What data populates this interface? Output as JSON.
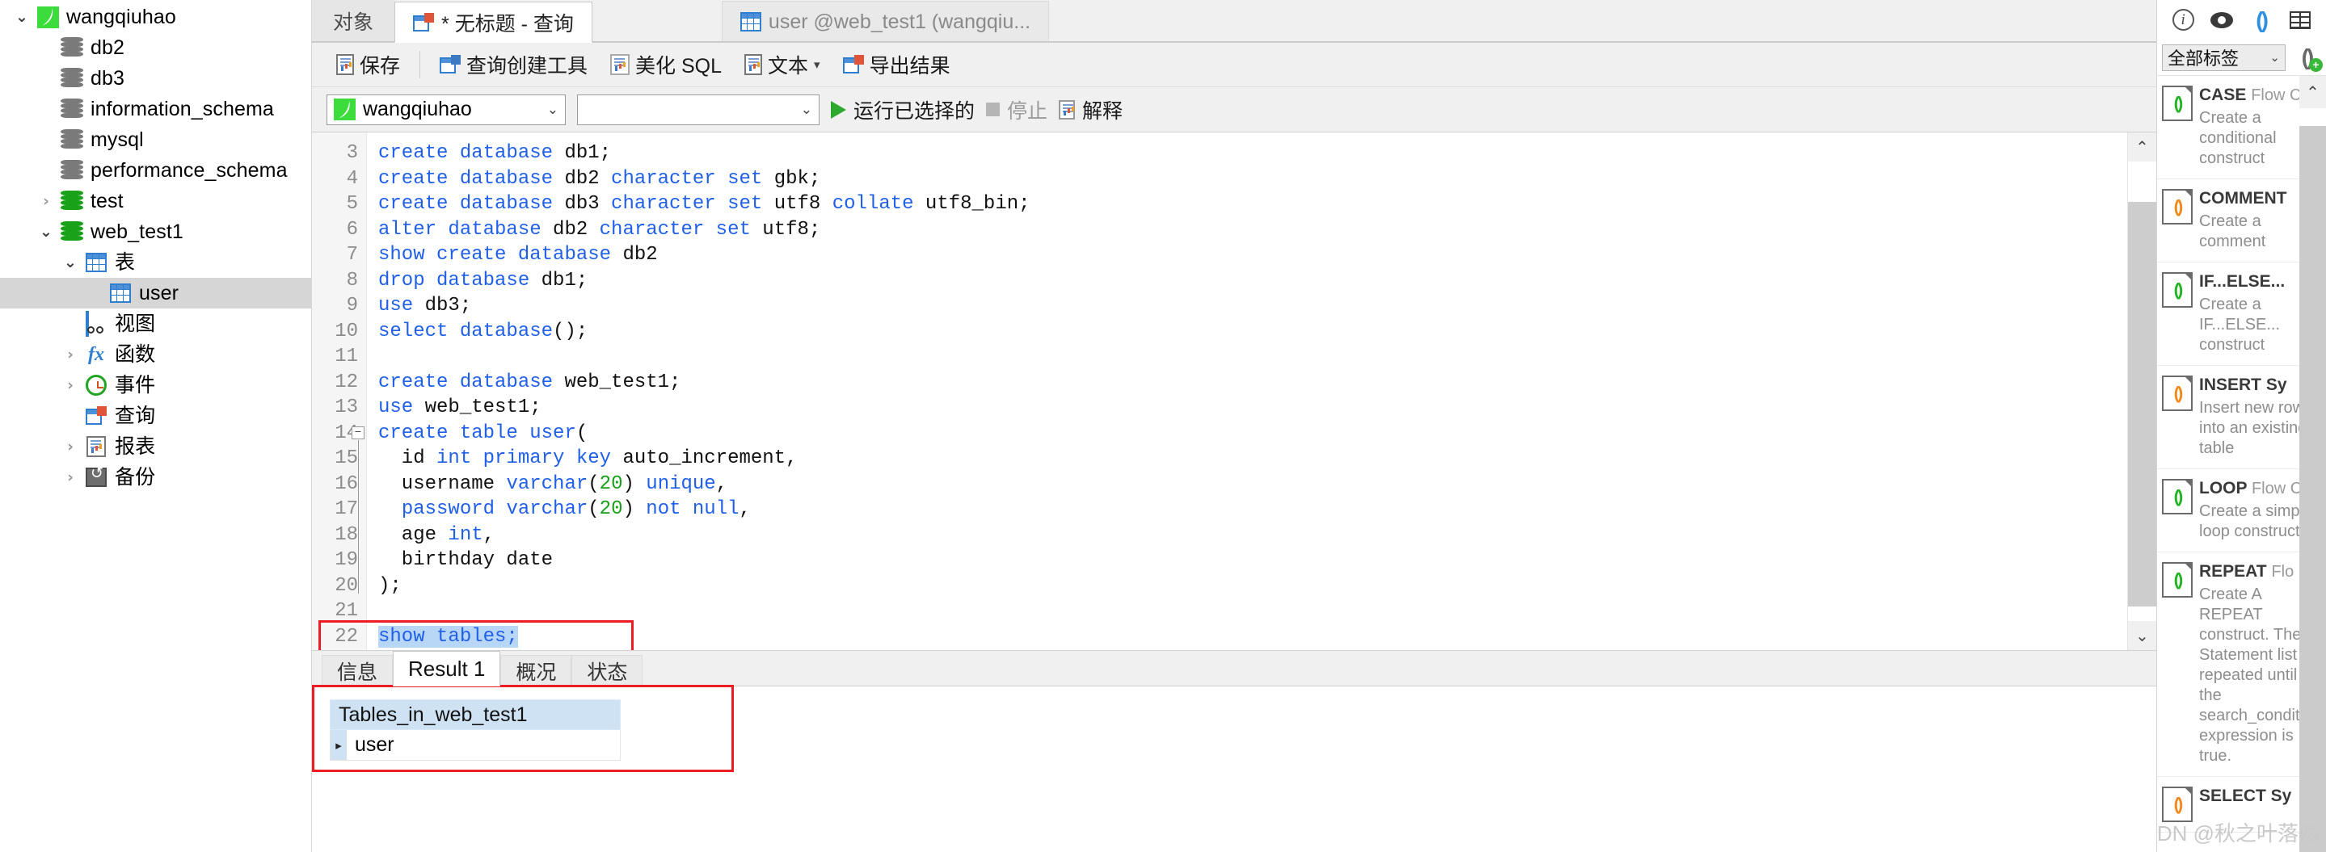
{
  "sidebar": {
    "items": [
      {
        "label": "wangqiuhao",
        "icon": "navicat-leaf-icon",
        "twisty": "open",
        "indent": 0,
        "selected": false
      },
      {
        "label": "db2",
        "icon": "database-gray-icon",
        "twisty": "none",
        "indent": 1,
        "selected": false
      },
      {
        "label": "db3",
        "icon": "database-gray-icon",
        "twisty": "none",
        "indent": 1,
        "selected": false
      },
      {
        "label": "information_schema",
        "icon": "database-gray-icon",
        "twisty": "none",
        "indent": 1,
        "selected": false
      },
      {
        "label": "mysql",
        "icon": "database-gray-icon",
        "twisty": "none",
        "indent": 1,
        "selected": false
      },
      {
        "label": "performance_schema",
        "icon": "database-gray-icon",
        "twisty": "none",
        "indent": 1,
        "selected": false
      },
      {
        "label": "test",
        "icon": "database-green-icon",
        "twisty": "closed",
        "indent": 1,
        "selected": false
      },
      {
        "label": "web_test1",
        "icon": "database-green-icon",
        "twisty": "open",
        "indent": 1,
        "selected": false
      },
      {
        "label": "表",
        "icon": "table-grid-icon",
        "twisty": "open",
        "indent": 2,
        "selected": false
      },
      {
        "label": "user",
        "icon": "table-grid-icon",
        "twisty": "none",
        "indent": 3,
        "selected": true
      },
      {
        "label": "视图",
        "icon": "view-icon",
        "twisty": "none",
        "indent": 2,
        "selected": false
      },
      {
        "label": "函数",
        "icon": "function-fx-icon",
        "twisty": "closed",
        "indent": 2,
        "selected": false
      },
      {
        "label": "事件",
        "icon": "clock-icon",
        "twisty": "closed",
        "indent": 2,
        "selected": false
      },
      {
        "label": "查询",
        "icon": "query-icon",
        "twisty": "none",
        "indent": 2,
        "selected": false
      },
      {
        "label": "报表",
        "icon": "report-icon",
        "twisty": "closed",
        "indent": 2,
        "selected": false
      },
      {
        "label": "备份",
        "icon": "backup-icon",
        "twisty": "closed",
        "indent": 2,
        "selected": false
      }
    ]
  },
  "tabbar": {
    "object_tab": "对象",
    "tabs": [
      {
        "label": "* 无标题 - 查询",
        "icon": "query-icon",
        "active": true
      },
      {
        "label": "user @web_test1 (wangqiu...",
        "icon": "table-grid-icon",
        "active": false
      }
    ]
  },
  "toolbar": {
    "save": "保存",
    "query_builder": "查询创建工具",
    "beautify_sql": "美化 SQL",
    "text": "文本",
    "export_result": "导出结果"
  },
  "toolbar2": {
    "connection_value": "wangqiuhao",
    "database_value": "",
    "run_selected": "运行已选择的",
    "stop": "停止",
    "explain": "解释"
  },
  "editor": {
    "first_line_number": 3,
    "lines": [
      {
        "n": 3,
        "tokens": [
          {
            "t": "create database ",
            "c": "kw"
          },
          {
            "t": "db1;",
            "c": "pl"
          }
        ]
      },
      {
        "n": 4,
        "tokens": [
          {
            "t": "create database ",
            "c": "kw"
          },
          {
            "t": "db2 ",
            "c": "pl"
          },
          {
            "t": "character set ",
            "c": "kw"
          },
          {
            "t": "gbk;",
            "c": "pl"
          }
        ]
      },
      {
        "n": 5,
        "tokens": [
          {
            "t": "create database ",
            "c": "kw"
          },
          {
            "t": "db3 ",
            "c": "pl"
          },
          {
            "t": "character set ",
            "c": "kw"
          },
          {
            "t": "utf8 ",
            "c": "pl"
          },
          {
            "t": "collate ",
            "c": "kw"
          },
          {
            "t": "utf8_bin;",
            "c": "pl"
          }
        ]
      },
      {
        "n": 6,
        "tokens": [
          {
            "t": "alter database ",
            "c": "kw"
          },
          {
            "t": "db2 ",
            "c": "pl"
          },
          {
            "t": "character set ",
            "c": "kw"
          },
          {
            "t": "utf8;",
            "c": "pl"
          }
        ]
      },
      {
        "n": 7,
        "tokens": [
          {
            "t": "show create database ",
            "c": "kw"
          },
          {
            "t": "db2",
            "c": "pl"
          }
        ]
      },
      {
        "n": 8,
        "tokens": [
          {
            "t": "drop database ",
            "c": "kw"
          },
          {
            "t": "db1;",
            "c": "pl"
          }
        ]
      },
      {
        "n": 9,
        "tokens": [
          {
            "t": "use ",
            "c": "kw"
          },
          {
            "t": "db3;",
            "c": "pl"
          }
        ]
      },
      {
        "n": 10,
        "tokens": [
          {
            "t": "select database",
            "c": "kw"
          },
          {
            "t": "();",
            "c": "pl"
          }
        ]
      },
      {
        "n": 11,
        "tokens": []
      },
      {
        "n": 12,
        "tokens": [
          {
            "t": "create database ",
            "c": "kw"
          },
          {
            "t": "web_test1;",
            "c": "pl"
          }
        ]
      },
      {
        "n": 13,
        "tokens": [
          {
            "t": "use ",
            "c": "kw"
          },
          {
            "t": "web_test1;",
            "c": "pl"
          }
        ]
      },
      {
        "n": 14,
        "tokens": [
          {
            "t": "create table ",
            "c": "kw"
          },
          {
            "t": "user",
            "c": "kw"
          },
          {
            "t": "(",
            "c": "pl"
          }
        ]
      },
      {
        "n": 15,
        "tokens": [
          {
            "t": "  id ",
            "c": "pl"
          },
          {
            "t": "int primary key ",
            "c": "kw"
          },
          {
            "t": "auto_increment,",
            "c": "pl"
          }
        ]
      },
      {
        "n": 16,
        "tokens": [
          {
            "t": "  username ",
            "c": "pl"
          },
          {
            "t": "varchar",
            "c": "kw"
          },
          {
            "t": "(",
            "c": "pl"
          },
          {
            "t": "20",
            "c": "num"
          },
          {
            "t": ") ",
            "c": "pl"
          },
          {
            "t": "unique",
            "c": "kw"
          },
          {
            "t": ",",
            "c": "pl"
          }
        ]
      },
      {
        "n": 17,
        "tokens": [
          {
            "t": "  ",
            "c": "pl"
          },
          {
            "t": "password ",
            "c": "kw"
          },
          {
            "t": "varchar",
            "c": "kw"
          },
          {
            "t": "(",
            "c": "pl"
          },
          {
            "t": "20",
            "c": "num"
          },
          {
            "t": ") ",
            "c": "pl"
          },
          {
            "t": "not null",
            "c": "kw"
          },
          {
            "t": ",",
            "c": "pl"
          }
        ]
      },
      {
        "n": 18,
        "tokens": [
          {
            "t": "  age ",
            "c": "pl"
          },
          {
            "t": "int",
            "c": "kw"
          },
          {
            "t": ",",
            "c": "pl"
          }
        ]
      },
      {
        "n": 19,
        "tokens": [
          {
            "t": "  birthday date",
            "c": "pl"
          }
        ]
      },
      {
        "n": 20,
        "tokens": [
          {
            "t": ");",
            "c": "pl"
          }
        ]
      },
      {
        "n": 21,
        "tokens": []
      },
      {
        "n": 22,
        "tokens": [
          {
            "t": "show tables;",
            "c": "kw",
            "sel": true
          }
        ]
      }
    ]
  },
  "results": {
    "tabs": [
      {
        "label": "信息",
        "active": false
      },
      {
        "label": "Result 1",
        "active": true
      },
      {
        "label": "概况",
        "active": false
      },
      {
        "label": "状态",
        "active": false
      }
    ],
    "column_header": "Tables_in_web_test1",
    "rows": [
      {
        "marker": "▸",
        "value": "user"
      }
    ]
  },
  "right_panel": {
    "icons": [
      "info-icon",
      "eye-icon",
      "parentheses-icon",
      "table-split-icon"
    ],
    "filter_value": "全部标签",
    "add_button": "add-snippet-icon",
    "snippets": [
      {
        "title": "CASE",
        "category": "Flow C",
        "desc": "Create a conditional construct",
        "icon_style": "green"
      },
      {
        "title": "COMMENT",
        "category": "",
        "desc": "Create a comment",
        "icon_style": "multi"
      },
      {
        "title": "IF...ELSE...",
        "category": "",
        "desc": "Create a IF...ELSE... construct",
        "icon_style": "green"
      },
      {
        "title": "INSERT Sy",
        "category": "",
        "desc": "Insert new rows into an existing table",
        "icon_style": "multi"
      },
      {
        "title": "LOOP",
        "category": "Flow C",
        "desc": "Create a simple loop construct",
        "icon_style": "green"
      },
      {
        "title": "REPEAT",
        "category": "Flo",
        "desc": "Create A REPEAT construct. The Statement list is repeated until the search_condition expression is true.",
        "icon_style": "green"
      },
      {
        "title": "SELECT Sy",
        "category": "",
        "desc": "",
        "icon_style": "multi"
      }
    ]
  },
  "watermark": "CSDN @秋之叶落殇",
  "colors": {
    "keyword": "#2060e8",
    "number": "#18a018",
    "selection": "#b8d6f5",
    "highlight_box": "#ee1c25",
    "tree_selected": "#d6d6d6",
    "grid_header": "#cfe2f3"
  }
}
